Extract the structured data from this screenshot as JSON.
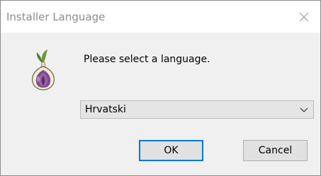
{
  "window": {
    "title": "Installer Language",
    "close_icon": "close-icon"
  },
  "content": {
    "app_icon": "tor-onion-icon",
    "prompt": "Please select a language."
  },
  "language_select": {
    "selected": "Hrvatski",
    "arrow_icon": "chevron-down-icon"
  },
  "buttons": {
    "ok_label": "OK",
    "cancel_label": "Cancel"
  },
  "colors": {
    "focus_border": "#0078d7",
    "dialog_background": "#f0f0f0",
    "title_text": "#8c8c8c"
  }
}
